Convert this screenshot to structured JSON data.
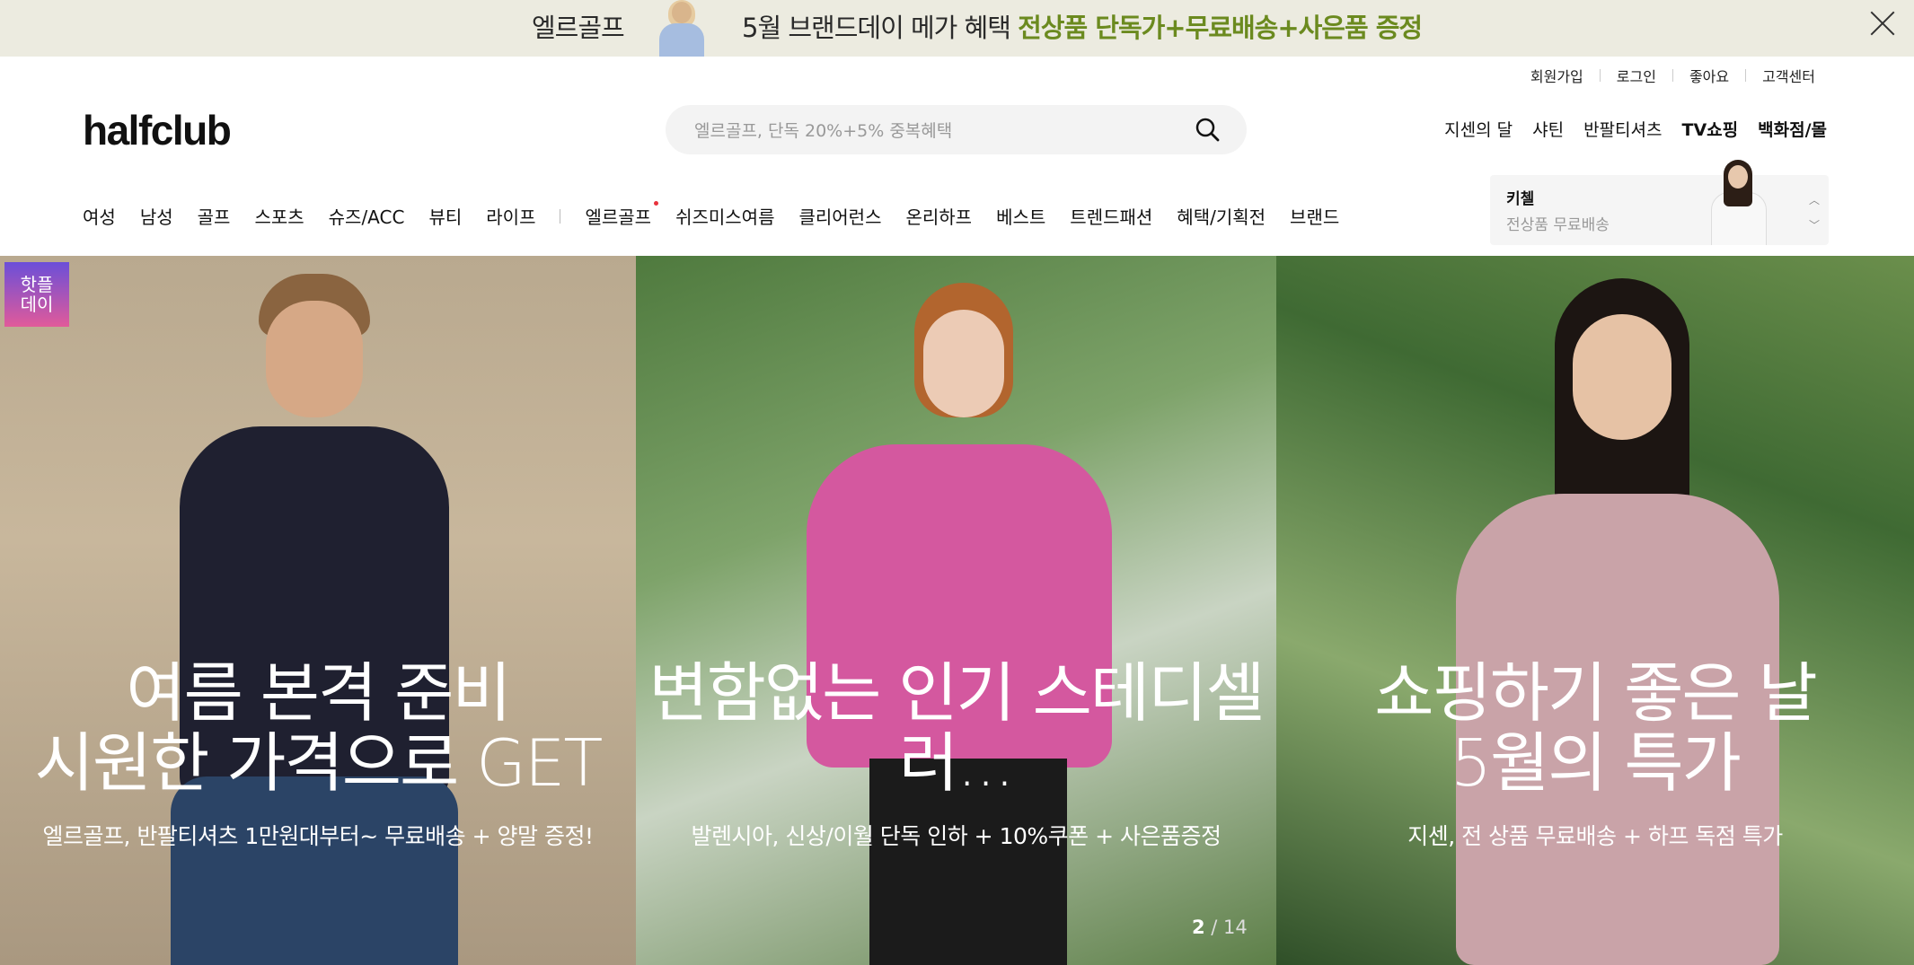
{
  "banner": {
    "brand": "엘르골프",
    "message_prefix": "5월 브랜드데이 메가 혜택 ",
    "message_highlight": "전상품 단독가+무료배송+사은품 증정"
  },
  "util_links": [
    "회원가입",
    "로그인",
    "좋아요",
    "고객센터"
  ],
  "logo": "halfclub",
  "search": {
    "placeholder": "엘르골프, 단독 20%+5% 중복혜택"
  },
  "shortcuts": [
    "지센의 달",
    "샤틴",
    "반팔티셔츠",
    "TV쇼핑",
    "백화점/몰"
  ],
  "nav": {
    "group1": [
      "여성",
      "남성",
      "골프",
      "스포츠",
      "슈즈/ACC",
      "뷰티",
      "라이프"
    ],
    "group2": [
      "엘르골프",
      "쉬즈미스여름",
      "클리어런스",
      "온리하프",
      "베스트",
      "트렌드패션",
      "혜택/기획전",
      "브랜드"
    ]
  },
  "promo": {
    "title": "키첼",
    "subtitle": "전상품 무료배송"
  },
  "slides": [
    {
      "badge_line1": "핫플",
      "badge_line2": "데이",
      "headline1": "여름 본격 준비",
      "headline2": "시원한 가격으로 GET",
      "sub": "엘르골프, 반팔티셔츠 1만원대부터~ 무료배송 + 양말 증정!"
    },
    {
      "headline1": "변함없는 인기 스테디셀",
      "headline2": "러...",
      "sub": "발렌시아, 신상/이월 단독 인하 + 10%쿠폰 + 사은품증정"
    },
    {
      "headline1": "쇼핑하기 좋은 날",
      "headline2": "5월의 특가",
      "sub": "지센, 전 상품 무료배송 + 하프 독점 특가"
    }
  ],
  "pager": {
    "current": "2",
    "total": " / 14"
  }
}
